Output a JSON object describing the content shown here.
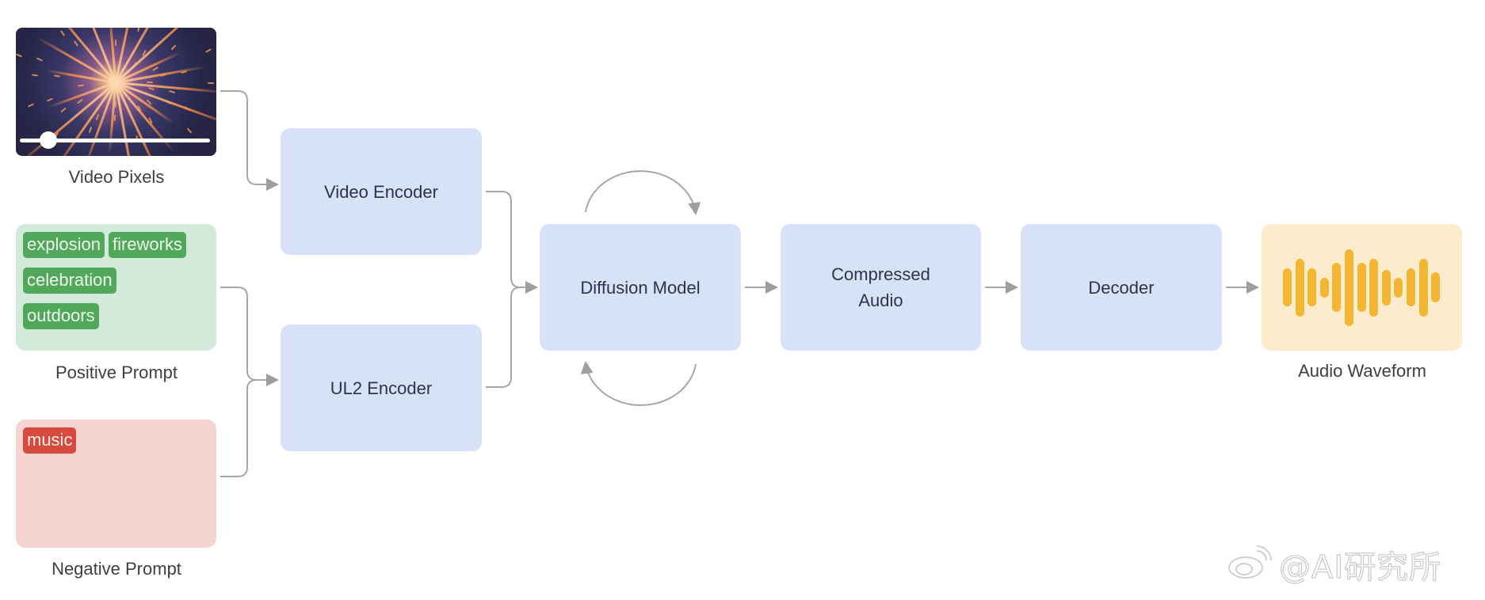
{
  "inputs": {
    "video": {
      "caption": "Video Pixels",
      "playback_progress": 0.15
    },
    "positive_prompt": {
      "caption": "Positive Prompt",
      "tags": [
        "explosion",
        "fireworks",
        "celebration",
        "outdoors"
      ],
      "tag_color": "#52a85a",
      "background": "#d3e9da"
    },
    "negative_prompt": {
      "caption": "Negative Prompt",
      "tags": [
        "music"
      ],
      "tag_color": "#d84a3e",
      "background": "#f4d3d1"
    }
  },
  "nodes": {
    "video_encoder": "Video Encoder",
    "ul2_encoder": "UL2 Encoder",
    "diffusion_model": "Diffusion Model",
    "compressed_audio": "Compressed Audio",
    "decoder": "Decoder"
  },
  "output": {
    "caption": "Audio Waveform",
    "waveform_levels": [
      0.48,
      0.73,
      0.48,
      0.25,
      0.62,
      0.97,
      0.62,
      0.73,
      0.45,
      0.25,
      0.48,
      0.73,
      0.38
    ],
    "bar_color": "#f2b632",
    "background": "#fdeccb"
  },
  "colors": {
    "node_fill": "#d7e2f8",
    "connector": "#9e9e9e"
  },
  "watermark": {
    "text": "@AI研究所",
    "icon": "weibo-logo-icon"
  }
}
